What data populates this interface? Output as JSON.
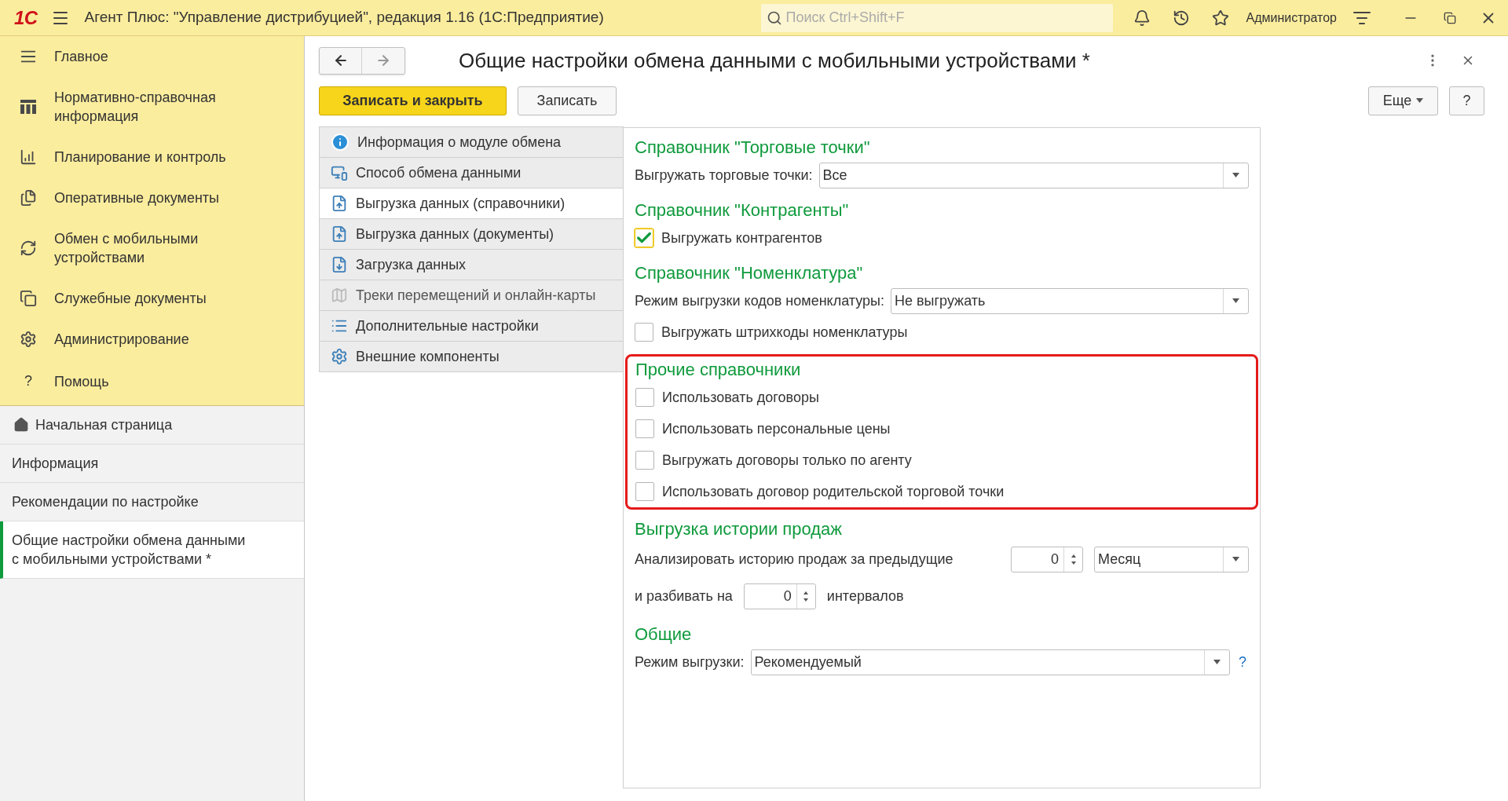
{
  "titlebar": {
    "logo": "1С",
    "title": "Агент Плюс: \"Управление дистрибуцией\", редакция 1.16  (1С:Предприятие)",
    "search": {
      "placeholder": "Поиск Ctrl+Shift+F"
    },
    "user": "Администратор"
  },
  "sections": [
    {
      "label": "Главное"
    },
    {
      "label": "Нормативно-справочная информация"
    },
    {
      "label": "Планирование и контроль"
    },
    {
      "label": "Оперативные документы"
    },
    {
      "label": "Обмен с мобильными устройствами"
    },
    {
      "label": "Служебные документы"
    },
    {
      "label": "Администрирование"
    },
    {
      "label": "Помощь",
      "glyph": "?"
    }
  ],
  "open_pages": [
    {
      "label": "Начальная страница",
      "kind": "home",
      "selected": false
    },
    {
      "label": "Информация",
      "kind": "page",
      "selected": false
    },
    {
      "label": "Рекомендации по настройке",
      "kind": "page",
      "selected": false
    },
    {
      "label": "Общие настройки обмена данными с мобильными устройствами *",
      "kind": "page",
      "selected": true
    }
  ],
  "form": {
    "title": "Общие настройки обмена данными с мобильными устройствами *",
    "buttons": [
      {
        "label": "Записать и закрыть",
        "kind": "primary"
      },
      {
        "label": "Записать",
        "kind": "normal"
      }
    ],
    "more": "Еще",
    "help": "?"
  },
  "nav": [
    {
      "label": "Информация о модуле обмена",
      "selected": false,
      "disabled": false
    },
    {
      "label": "Способ обмена данными",
      "selected": false,
      "disabled": false
    },
    {
      "label": "Выгрузка данных (справочники)",
      "selected": true,
      "disabled": false
    },
    {
      "label": "Выгрузка данных (документы)",
      "selected": false,
      "disabled": false
    },
    {
      "label": "Загрузка данных",
      "selected": false,
      "disabled": false
    },
    {
      "label": "Треки перемещений и онлайн-карты",
      "selected": false,
      "disabled": true
    },
    {
      "label": "Дополнительные настройки",
      "selected": false,
      "disabled": false
    },
    {
      "label": "Внешние компоненты",
      "selected": false,
      "disabled": false
    }
  ],
  "groups": [
    {
      "title": "Справочник \"Торговые точки\"",
      "highlighted": false,
      "rows": [
        {
          "kind": "select",
          "label": "Выгружать торговые точки:",
          "value": "Все"
        }
      ]
    },
    {
      "title": "Справочник \"Контрагенты\"",
      "highlighted": false,
      "rows": [
        {
          "kind": "checkbox",
          "label": "Выгружать контрагентов",
          "checked": true,
          "focused": true
        }
      ]
    },
    {
      "title": "Справочник \"Номенклатура\"",
      "highlighted": false,
      "rows": [
        {
          "kind": "select",
          "label": "Режим выгрузки кодов номенклатуры:",
          "value": "Не выгружать"
        },
        {
          "kind": "checkbox",
          "label": "Выгружать штрихкоды номенклатуры",
          "checked": false,
          "focused": false
        }
      ]
    },
    {
      "title": "Прочие справочники",
      "highlighted": true,
      "rows": [
        {
          "kind": "checkbox",
          "label": "Использовать договоры",
          "checked": false,
          "focused": false
        },
        {
          "kind": "checkbox",
          "label": "Использовать персональные цены",
          "checked": false,
          "focused": false
        },
        {
          "kind": "checkbox",
          "label": "Выгружать договоры только по агенту",
          "checked": false,
          "focused": false
        },
        {
          "kind": "checkbox",
          "label": "Использовать договор родительской торговой точки",
          "checked": false,
          "focused": false
        }
      ]
    },
    {
      "title": "Выгрузка истории продаж",
      "highlighted": false,
      "rows": [
        {
          "kind": "spin_select",
          "label": "Анализировать историю продаж за предыдущие",
          "number": "0",
          "value": "Месяц"
        },
        {
          "kind": "spin",
          "label": "и разбивать на",
          "number": "0",
          "suffix": "интервалов"
        }
      ]
    },
    {
      "title": "Общие",
      "highlighted": false,
      "rows": [
        {
          "kind": "select_help",
          "label": "Режим выгрузки:",
          "value": "Рекомендуемый",
          "help": "?"
        }
      ]
    }
  ]
}
